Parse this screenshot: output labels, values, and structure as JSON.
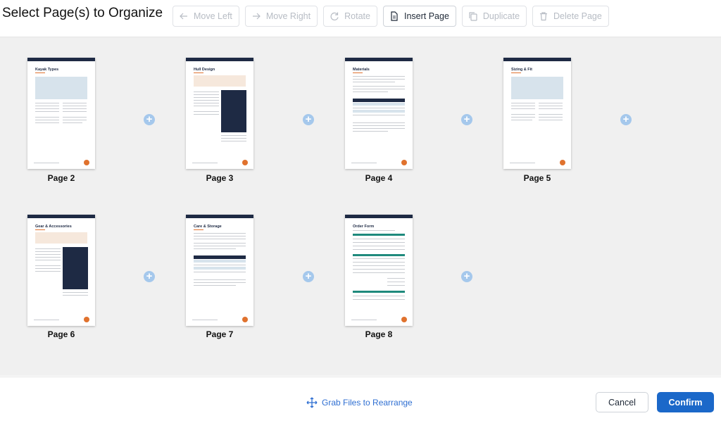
{
  "header": {
    "title": "Select Page(s) to Organize",
    "toolbar": {
      "move_left": "Move Left",
      "move_right": "Move Right",
      "rotate": "Rotate",
      "insert_page": "Insert Page",
      "duplicate": "Duplicate",
      "delete_page": "Delete Page"
    }
  },
  "pages": [
    {
      "label": "Page 2",
      "title": "Kayak Types"
    },
    {
      "label": "Page 3",
      "title": "Hull Design"
    },
    {
      "label": "Page 4",
      "title": "Materials"
    },
    {
      "label": "Page 5",
      "title": "Sizing & Fit"
    },
    {
      "label": "Page 6",
      "title": "Gear & Accessories"
    },
    {
      "label": "Page 7",
      "title": "Care & Storage"
    },
    {
      "label": "Page 8",
      "title": "Order Form"
    }
  ],
  "footer": {
    "grab_label": "Grab Files to Rearrange",
    "cancel_label": "Cancel",
    "confirm_label": "Confirm"
  },
  "colors": {
    "accent": "#1b68c9",
    "insert_plus": "#a5c8ec",
    "page_header": "#1e2a44",
    "page_badge": "#e0722e"
  }
}
